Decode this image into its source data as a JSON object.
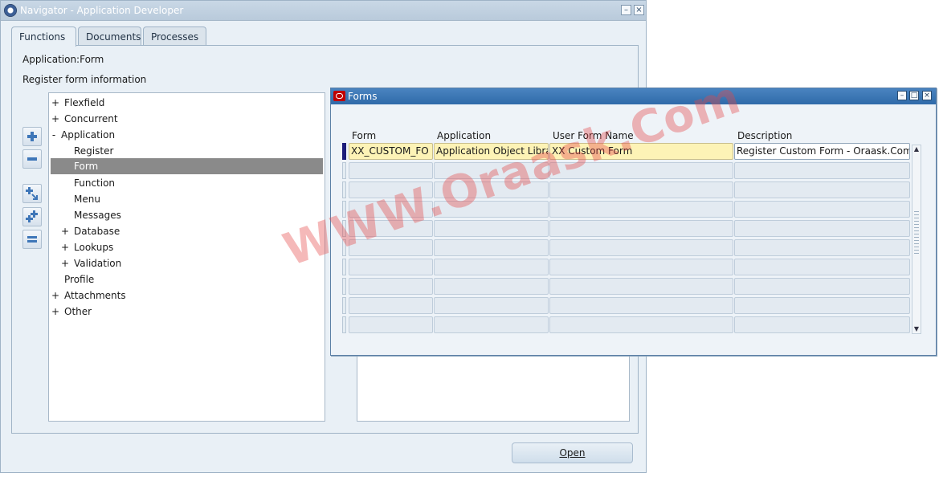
{
  "navigator": {
    "title": "Navigator - Application Developer",
    "tabs": [
      "Functions",
      "Documents",
      "Processes"
    ],
    "active_tab": "Functions",
    "context_line": "Application:Form",
    "description_line": "Register form information",
    "tree": [
      {
        "expander": "+",
        "label": "Flexfield",
        "level": 0
      },
      {
        "expander": "+",
        "label": "Concurrent",
        "level": 0
      },
      {
        "expander": "-",
        "label": "Application",
        "level": 0
      },
      {
        "expander": "",
        "label": "Register",
        "level": 1
      },
      {
        "expander": "",
        "label": "Form",
        "level": 1,
        "selected": true
      },
      {
        "expander": "",
        "label": "Function",
        "level": 1
      },
      {
        "expander": "",
        "label": "Menu",
        "level": 1
      },
      {
        "expander": "",
        "label": "Messages",
        "level": 1
      },
      {
        "expander": "+",
        "label": "Database",
        "level": 1
      },
      {
        "expander": "+",
        "label": "Lookups",
        "level": 1
      },
      {
        "expander": "+",
        "label": "Validation",
        "level": 1
      },
      {
        "expander": "",
        "label": "Profile",
        "level": 0
      },
      {
        "expander": "+",
        "label": "Attachments",
        "level": 0
      },
      {
        "expander": "+",
        "label": "Other",
        "level": 0
      }
    ],
    "side_buttons": [
      "expand-icon",
      "collapse-icon",
      "expand-branch-icon",
      "expand-all-icon",
      "collapse-all-icon"
    ],
    "open_button": "Open"
  },
  "forms": {
    "title": "Forms",
    "columns": [
      "Form",
      "Application",
      "User Form Name",
      "Description"
    ],
    "rows": [
      [
        "XX_CUSTOM_FO",
        "Application Object Libra",
        "XX Custom Form",
        "Register Custom Form - Oraask.Com"
      ],
      [
        "",
        "",
        "",
        ""
      ],
      [
        "",
        "",
        "",
        ""
      ],
      [
        "",
        "",
        "",
        ""
      ],
      [
        "",
        "",
        "",
        ""
      ],
      [
        "",
        "",
        "",
        ""
      ],
      [
        "",
        "",
        "",
        ""
      ],
      [
        "",
        "",
        "",
        ""
      ],
      [
        "",
        "",
        "",
        ""
      ],
      [
        "",
        "",
        "",
        ""
      ]
    ]
  },
  "watermark": "WWW.Oraask.Com",
  "colors": {
    "window_bg": "#e9f0f6",
    "forms_title": "#2f6aa9",
    "required_field": "#fdf3b6",
    "selected_row": "#8a8a8a"
  }
}
